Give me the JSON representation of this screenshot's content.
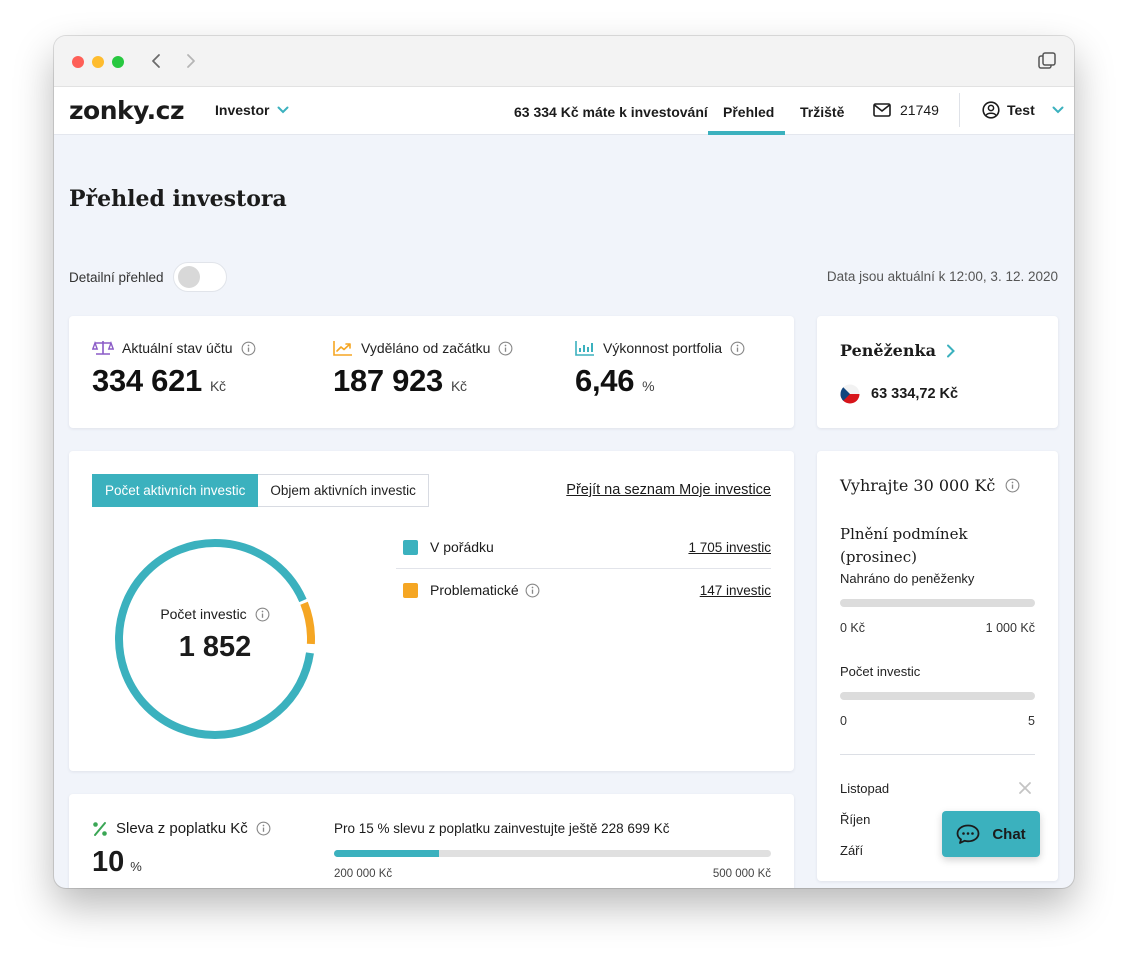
{
  "browser": {
    "controls": [
      "close",
      "minimize",
      "zoom"
    ]
  },
  "header": {
    "logo": "zonky.cz",
    "role_dropdown": "Investor",
    "balance_text": "63 334 Kč máte k investování",
    "nav": {
      "overview": "Přehled",
      "market": "Tržiště"
    },
    "messages_count": "21749",
    "user": "Test"
  },
  "page": {
    "title": "Přehled investora",
    "detail_toggle_label": "Detailní přehled",
    "updated_text": "Data jsou aktuální k 12:00, 3. 12. 2020"
  },
  "stats": [
    {
      "label": "Aktuální stav účtu",
      "value": "334 621",
      "unit": "Kč",
      "icon": "scale-icon"
    },
    {
      "label": "Vyděláno od začátku",
      "value": "187 923",
      "unit": "Kč",
      "icon": "trend-up-icon"
    },
    {
      "label": "Výkonnost portfolia",
      "value": "6,46",
      "unit": "%",
      "icon": "bar-chart-icon"
    }
  ],
  "wallet": {
    "title": "Peněženka",
    "amount": "63 334,72 Kč"
  },
  "investments": {
    "tab_count": "Počet aktivních investic",
    "tab_volume": "Objem aktivních investic",
    "list_link": "Přejít na seznam Moje investice",
    "donut_label": "Počet investic",
    "donut_total": "1 852",
    "donut_ok_count": 1705,
    "donut_problem_count": 147,
    "legend": [
      {
        "label": "V pořádku",
        "value": "1 705 investic",
        "color": "#3bb1be"
      },
      {
        "label": "Problematické",
        "value": "147 investic",
        "color": "#f5a623"
      }
    ]
  },
  "discount": {
    "label": "Sleva z poplatku Kč",
    "value": "10",
    "unit": "%",
    "text": "Pro 15 % slevu z poplatku zainvestujte ještě 228 699 Kč",
    "progress": 0.24,
    "min": "200 000 Kč",
    "max": "500 000 Kč"
  },
  "promo": {
    "title": "Vyhrajte 30 000 Kč",
    "subtitle": "Plnění podmínek (prosinec)",
    "wallet_upload_label": "Nahráno do peněženky",
    "wallet_min": "0 Kč",
    "wallet_max": "1 000 Kč",
    "count_label": "Počet investic",
    "count_min": "0",
    "count_max": "5",
    "months": [
      "Listopad",
      "Říjen",
      "Září"
    ]
  },
  "chat": {
    "label": "Chat"
  },
  "colors": {
    "accent": "#3bb1be",
    "warning": "#f5a623",
    "background": "#f1f4fa"
  }
}
